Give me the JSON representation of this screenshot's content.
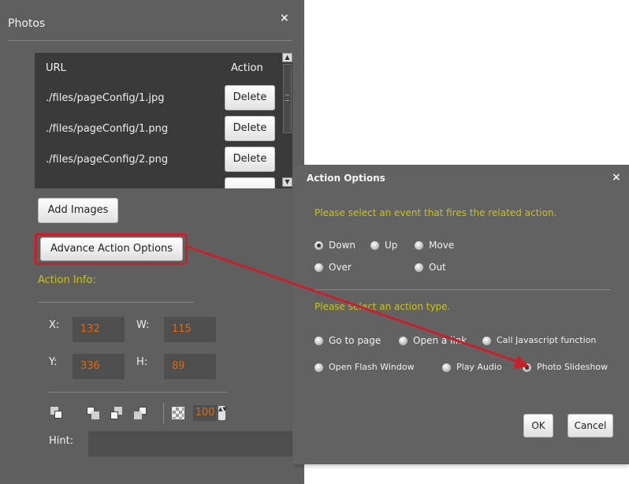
{
  "photos_panel": {
    "title": "Photos",
    "close": "×",
    "table": {
      "headers": {
        "url": "URL",
        "action": "Action"
      },
      "rows": [
        {
          "url": "./files/pageConfig/1.jpg",
          "action": "Delete"
        },
        {
          "url": "./files/pageConfig/1.png",
          "action": "Delete"
        },
        {
          "url": "./files/pageConfig/2.png",
          "action": "Delete"
        }
      ],
      "scroll_up": "▲",
      "scroll_down": "▼"
    },
    "add_images_label": "Add Images",
    "advance_action_label": "Advance Action Options",
    "action_info_label": "Action Info:",
    "coords": {
      "x_label": "X:",
      "x_value": "132",
      "w_label": "W:",
      "w_value": "115",
      "y_label": "Y:",
      "y_value": "336",
      "h_label": "H:",
      "h_value": "89"
    },
    "tools": {
      "icons": [
        "bring-to-front-icon",
        "bring-forward-icon",
        "send-backward-icon",
        "send-to-back-icon",
        "opacity-icon"
      ],
      "opacity_value": "100",
      "spinner": "▲▼"
    },
    "hint_label": "Hint:"
  },
  "action_dialog": {
    "title": "Action Options",
    "close": "×",
    "event_prompt": "Please select an event that fires the related action.",
    "events": [
      {
        "label": "Down",
        "selected": true
      },
      {
        "label": "Up",
        "selected": false
      },
      {
        "label": "Move",
        "selected": false
      },
      {
        "label": "Over",
        "selected": false
      },
      {
        "label": "Out",
        "selected": false
      }
    ],
    "action_prompt": "Please select an action type.",
    "actions": [
      {
        "label": "Go to page",
        "selected": false
      },
      {
        "label": "Open a link",
        "selected": false
      },
      {
        "label": "Call Javascript function",
        "selected": false
      },
      {
        "label": "Open Flash Window",
        "selected": false
      },
      {
        "label": "Play Audio",
        "selected": false
      },
      {
        "label": "Photo Slideshow",
        "selected": true
      }
    ],
    "ok_label": "OK",
    "cancel_label": "Cancel"
  },
  "colors": {
    "panel_bg": "#5f5f5f",
    "table_bg": "#3a3a3a",
    "accent_yellow": "#c9c218",
    "value_orange": "#d86a18",
    "annotation_red": "#c8202a"
  }
}
